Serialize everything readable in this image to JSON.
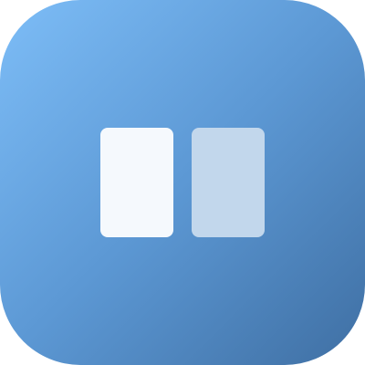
{
  "icon": {
    "name": "two-panel-app-icon",
    "gradient_colors": [
      "#7dbdf7",
      "#5c98d4",
      "#3f6fa3"
    ],
    "left_panel_color": "#f5f9fd",
    "right_panel_color": "#c2d7ec"
  }
}
